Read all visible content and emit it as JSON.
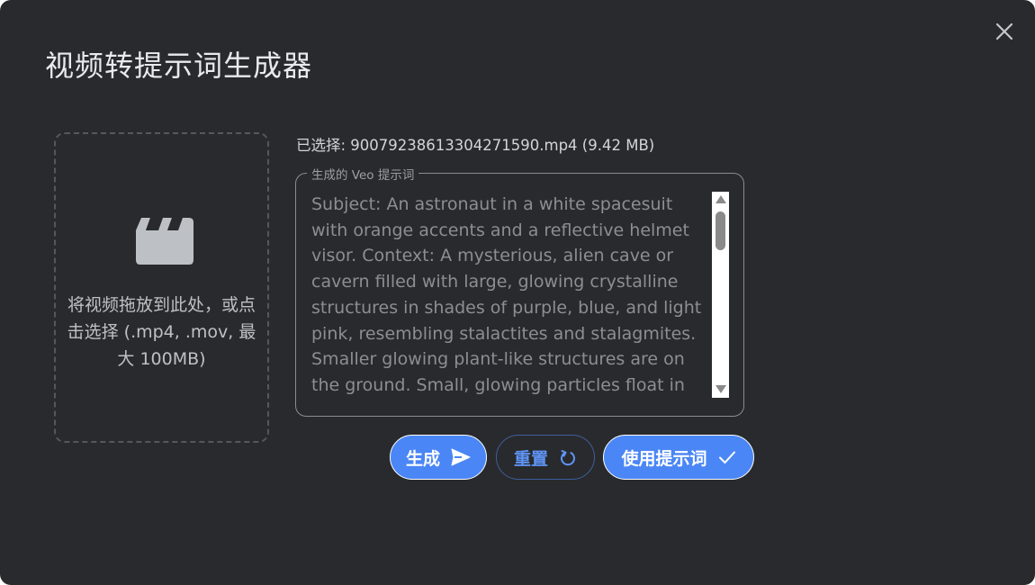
{
  "dialog": {
    "title": "视频转提示词生成器",
    "close_icon": "close-icon"
  },
  "dropzone": {
    "icon": "clapperboard-icon",
    "text": "将视频拖放到此处，或点击选择 (.mp4, .mov, 最大 100MB)"
  },
  "selected_file": {
    "text": "已选择: 9007923861330427159​0.mp4 (9.42 MB)"
  },
  "prompt": {
    "legend": "生成的 Veo 提示词",
    "text": "Subject: An astronaut in a white spacesuit with orange accents and a reflective helmet visor. Context: A mysterious, alien cave or cavern filled with large, glowing crystalline structures in shades of purple, blue, and light pink, resembling stalactites and stalagmites. Smaller glowing plant-like structures are on the ground. Small, glowing particles float in the air."
  },
  "buttons": {
    "generate": {
      "label": "生成",
      "icon": "send-icon"
    },
    "reset": {
      "label": "重置",
      "icon": "refresh-icon"
    },
    "use_prompt": {
      "label": "使用提示词",
      "icon": "check-icon"
    }
  },
  "colors": {
    "background": "#292a2d",
    "accent": "#4a86f5",
    "accent_text": "#5f95f6",
    "muted_text": "#8b8e93"
  }
}
